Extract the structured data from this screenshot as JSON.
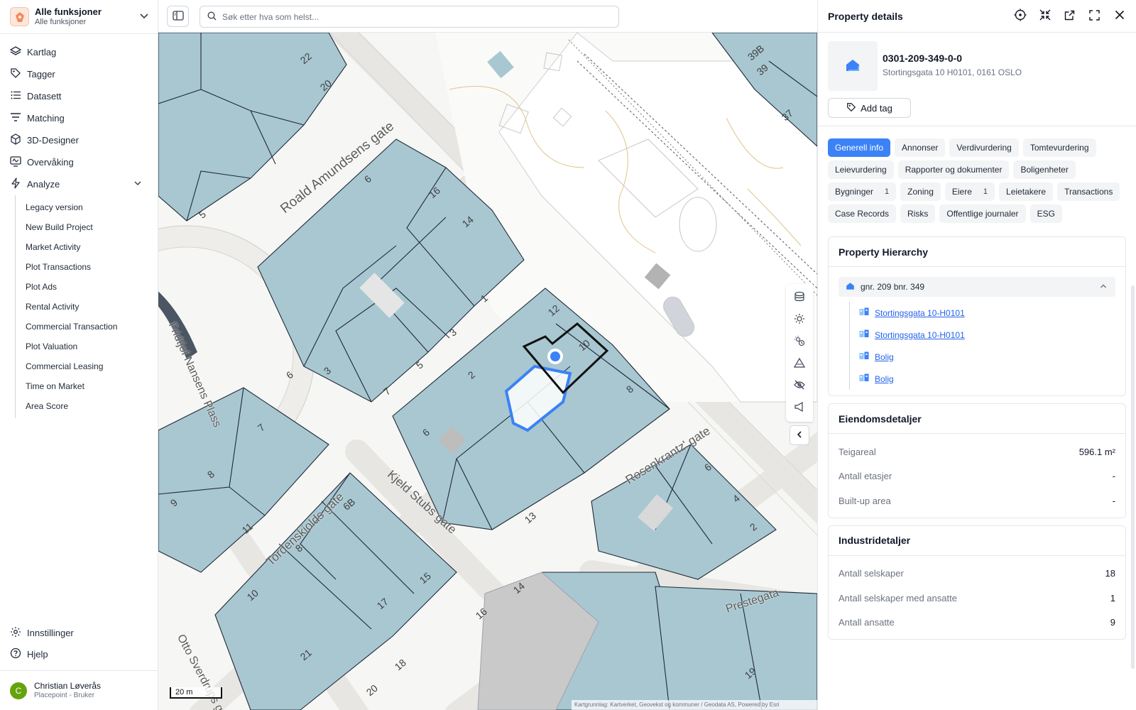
{
  "org": {
    "title": "Alle funksjoner",
    "subtitle": "Alle funksjoner"
  },
  "nav": {
    "kartlag": "Kartlag",
    "tagger": "Tagger",
    "datasett": "Datasett",
    "matching": "Matching",
    "designer": "3D-Designer",
    "overvaking": "Overvåking",
    "analyze": "Analyze",
    "analyze_items": [
      "Legacy version",
      "New Build Project",
      "Market Activity",
      "Plot Transactions",
      "Plot Ads",
      "Rental Activity",
      "Commercial Transaction",
      "Plot Valuation",
      "Commercial Leasing",
      "Time on Market",
      "Area Score"
    ],
    "settings": "Innstillinger",
    "help": "Hjelp"
  },
  "user": {
    "initial": "C",
    "name": "Christian Løverås",
    "role": "Placepoint - Bruker",
    "avatar_color": "#65a30d"
  },
  "search": {
    "placeholder": "Søk etter hva som helst..."
  },
  "map": {
    "streets": [
      "Roald Amundsens gate",
      "Fridtjof Nansens Plass",
      "Kjeld Stubs gate",
      "Rosenkrantz' gate",
      "Tordenskiolds gate",
      "Otto Sverdrups gate",
      "Prestegata"
    ],
    "numbers": [
      "22",
      "20",
      "6",
      "16",
      "14",
      "1",
      "3",
      "5",
      "7",
      "3",
      "12",
      "10",
      "2",
      "8",
      "6",
      "13",
      "6",
      "4",
      "2",
      "7",
      "8",
      "9",
      "11",
      "6B",
      "8",
      "15",
      "17",
      "10",
      "21",
      "18",
      "20",
      "14",
      "16",
      "19",
      "39B",
      "39",
      "37",
      "5",
      "6"
    ],
    "scale": "20 m",
    "attribution": "Kartgrunnlag: Kartverket, Geovekst og kommuner / Geodata AS, Powered by Esri",
    "parcel_color": "#a8c7d1",
    "selection_color": "#3b82f6"
  },
  "panel": {
    "title": "Property details",
    "property_id": "0301-209-349-0-0",
    "address": "Stortingsgata 10 H0101, 0161 OSLO",
    "add_tag": "Add tag",
    "tabs": [
      {
        "label": "Generell info",
        "count": ""
      },
      {
        "label": "Annonser",
        "count": ""
      },
      {
        "label": "Verdivurdering",
        "count": ""
      },
      {
        "label": "Tomtevurdering",
        "count": ""
      },
      {
        "label": "Leievurdering",
        "count": ""
      },
      {
        "label": "Rapporter og dokumenter",
        "count": ""
      },
      {
        "label": "Boligenheter",
        "count": ""
      },
      {
        "label": "Bygninger",
        "count": "1"
      },
      {
        "label": "Zoning",
        "count": ""
      },
      {
        "label": "Eiere",
        "count": "1"
      },
      {
        "label": "Leietakere",
        "count": ""
      },
      {
        "label": "Transactions",
        "count": ""
      },
      {
        "label": "Case Records",
        "count": ""
      },
      {
        "label": "Risks",
        "count": ""
      },
      {
        "label": "Offentlige journaler",
        "count": ""
      },
      {
        "label": "ESG",
        "count": ""
      }
    ],
    "active_tab": "Generell info",
    "hierarchy": {
      "title": "Property Hierarchy",
      "root": "gnr. 209 bnr. 349",
      "children": [
        "Stortingsgata 10-H0101",
        "Stortingsgata 10-H0101",
        "Bolig",
        "Bolig"
      ]
    },
    "eiendom": {
      "title": "Eiendomsdetaljer",
      "rows": [
        {
          "label": "Teigareal",
          "value": "596.1 m²"
        },
        {
          "label": "Antall etasjer",
          "value": "-"
        },
        {
          "label": "Built-up area",
          "value": "-"
        }
      ]
    },
    "industri": {
      "title": "Industridetaljer",
      "rows": [
        {
          "label": "Antall selskaper",
          "value": "18"
        },
        {
          "label": "Antall selskaper med ansatte",
          "value": "1"
        },
        {
          "label": "Antall ansatte",
          "value": "9"
        }
      ]
    }
  },
  "colors": {
    "accent": "#3b82f6",
    "link": "#2563eb"
  }
}
